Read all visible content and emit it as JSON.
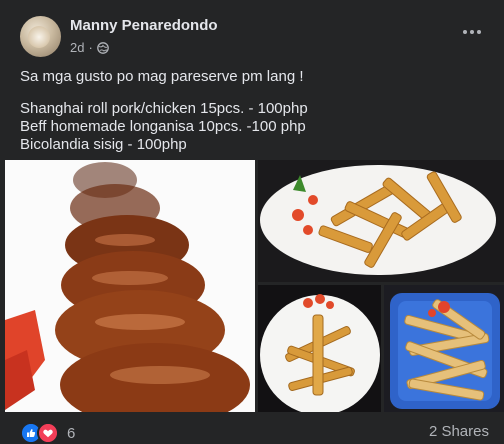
{
  "post": {
    "author": "Manny Penaredondo",
    "time": "2d",
    "separator": "·",
    "text_lines": [
      "Sa mga gusto po mag pareserve pm lang !",
      "Shanghai roll pork/chicken 15pcs. - 100php",
      "Beff homemade longanisa 10pcs. -100 php",
      "Bicolandia sisig - 100php"
    ],
    "icons": {
      "privacy": "globe-icon",
      "menu": "more-horizontal-icon",
      "like": "like-reaction-icon",
      "love": "love-reaction-icon"
    }
  },
  "footer": {
    "reaction_count": "6",
    "shares": "2 Shares"
  },
  "colors": {
    "background": "#242526",
    "primary_text": "#e4e6eb",
    "secondary_text": "#b0b3b8",
    "like_blue": "#1877f2",
    "love_red": "#f33e58"
  }
}
